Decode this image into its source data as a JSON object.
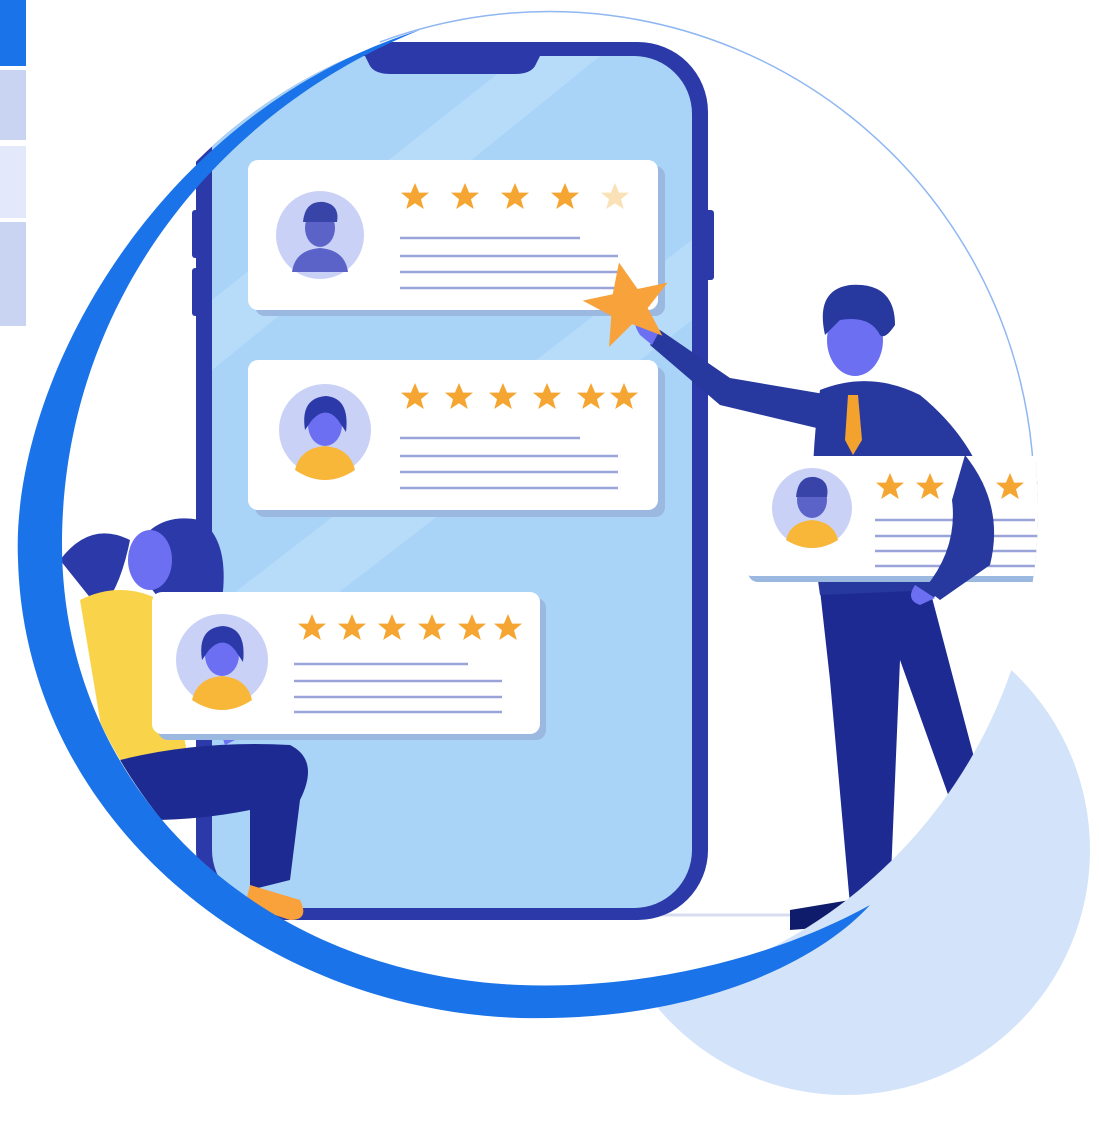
{
  "colors": {
    "primary_blue": "#1a73e8",
    "tab_active": "#1a73e8",
    "tab_light": "#c9d3f2",
    "tab_lighter": "#e3e8fb",
    "phone_frame": "#2b3aa8",
    "phone_screen": "#a9d4f8",
    "card": "#ffffff",
    "star": "#f5a531",
    "star_big": "#f7a23b",
    "deco_circle": "#d2e3fa",
    "man_body": "#27389e",
    "man_tie": "#f3a22e",
    "skin": "#6d6ff2",
    "woman_top": "#f9d44a",
    "woman_pants": "#1d2a91",
    "line": "#9aa4d8"
  },
  "review_cards": [
    {
      "avatar": "man-avatar-icon",
      "rating": 4.5,
      "max": 5
    },
    {
      "avatar": "woman-avatar-icon",
      "rating": 6,
      "max": 6
    },
    {
      "avatar": "woman-avatar-icon",
      "rating": 6,
      "max": 6
    },
    {
      "avatar": "man-avatar-icon",
      "rating": 5,
      "max": 5
    }
  ],
  "icons": [
    "star-icon",
    "man-avatar-icon",
    "woman-avatar-icon",
    "smartphone-icon"
  ]
}
